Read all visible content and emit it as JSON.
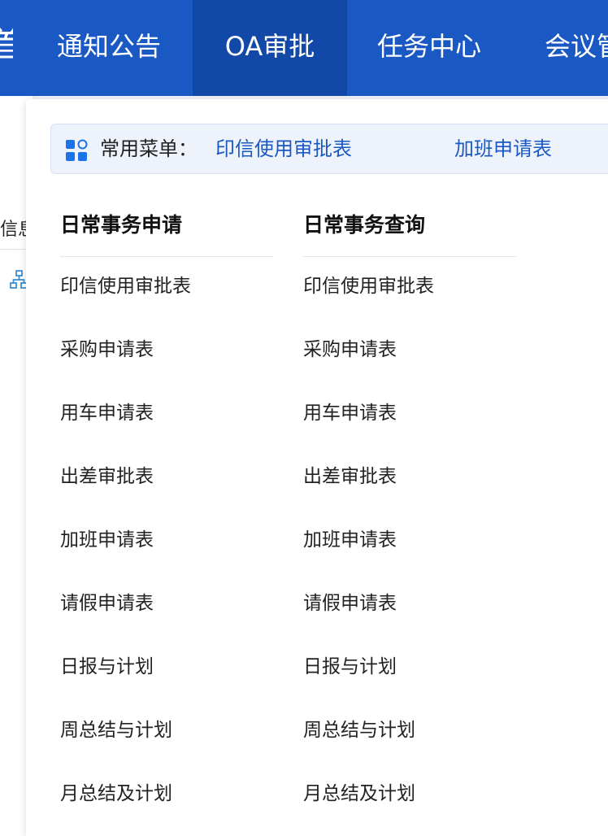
{
  "topnav": {
    "edge_glyph": "首",
    "items": [
      {
        "label": "通知公告"
      },
      {
        "label": "OA审批",
        "active": true
      },
      {
        "label": "任务中心"
      },
      {
        "label": "会议管"
      }
    ]
  },
  "background": {
    "tab_fragment": "信息",
    "icon": "org-chart-icon"
  },
  "quick_menu": {
    "icon": "apps-grid-icon",
    "label": "常用菜单：",
    "links": [
      "印信使用审批表",
      "加班申请表"
    ]
  },
  "columns": [
    {
      "title": "日常事务申请",
      "items": [
        "印信使用审批表",
        "采购申请表",
        "用车申请表",
        "出差审批表",
        "加班申请表",
        "请假申请表",
        "日报与计划",
        "周总结与计划",
        "月总结及计划"
      ]
    },
    {
      "title": "日常事务查询",
      "items": [
        "印信使用审批表",
        "采购申请表",
        "用车申请表",
        "出差审批表",
        "加班申请表",
        "请假申请表",
        "日报与计划",
        "周总结与计划",
        "月总结及计划"
      ]
    }
  ],
  "colors": {
    "nav_bg": "#1a58c4",
    "nav_active_bg": "#1249a8",
    "link": "#1a58c4",
    "quick_bar_bg": "#eef3fb"
  }
}
